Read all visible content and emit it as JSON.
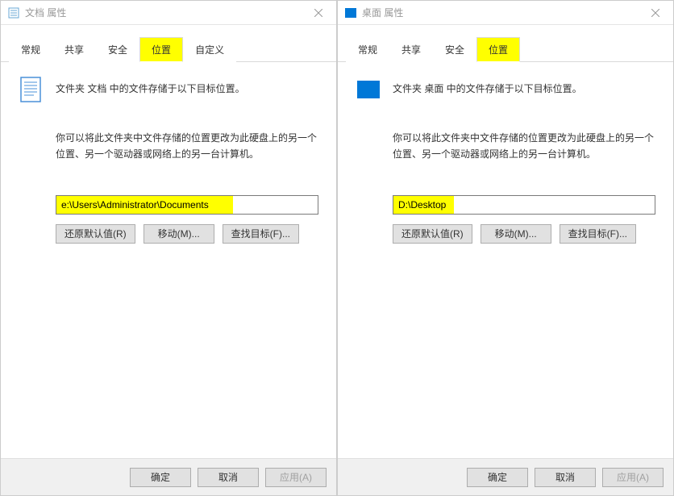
{
  "left": {
    "title": "文档 属性",
    "tabs": [
      "常规",
      "共享",
      "安全",
      "位置",
      "自定义"
    ],
    "active_tab": "位置",
    "header": "文件夹 文档 中的文件存储于以下目标位置。",
    "desc": "你可以将此文件夹中文件存储的位置更改为此硬盘上的另一个位置、另一个驱动器或网络上的另一台计算机。",
    "path": "e:\\Users\\Administrator\\Documents",
    "buttons": {
      "restore": "还原默认值(R)",
      "move": "移动(M)...",
      "find": "查找目标(F)..."
    },
    "bottom": {
      "ok": "确定",
      "cancel": "取消",
      "apply": "应用(A)"
    }
  },
  "right": {
    "title": "桌面 属性",
    "tabs": [
      "常规",
      "共享",
      "安全",
      "位置"
    ],
    "active_tab": "位置",
    "header": "文件夹 桌面 中的文件存储于以下目标位置。",
    "desc": "你可以将此文件夹中文件存储的位置更改为此硬盘上的另一个位置、另一个驱动器或网络上的另一台计算机。",
    "path": "D:\\Desktop",
    "buttons": {
      "restore": "还原默认值(R)",
      "move": "移动(M)...",
      "find": "查找目标(F)..."
    },
    "bottom": {
      "ok": "确定",
      "cancel": "取消",
      "apply": "应用(A)"
    }
  }
}
